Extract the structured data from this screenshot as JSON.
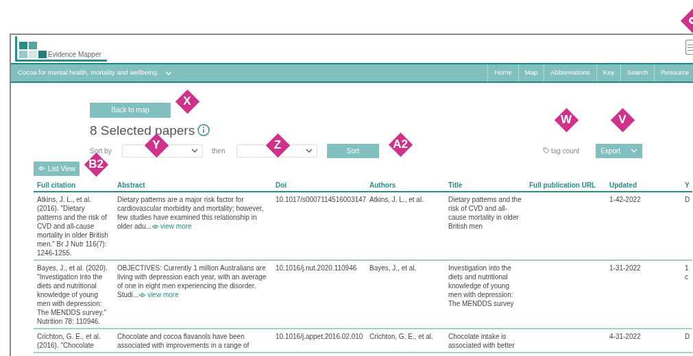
{
  "header": {
    "logo_text": "Evidence Mapper"
  },
  "nav": {
    "topic": "Cocoa for mental health, mortality and wellbeing.",
    "links": [
      "Home",
      "Map",
      "Abbreviations",
      "Key",
      "Search",
      "Resource"
    ]
  },
  "back_button": "Back to map",
  "heading": "8 Selected papers",
  "sort": {
    "label": "Sort by",
    "then": "then",
    "button": "Sort"
  },
  "tag_count": "tag count",
  "export_button": "Export",
  "list_view_button": "List View",
  "table": {
    "columns": [
      "Full citation",
      "Abstract",
      "Doi",
      "Authors",
      "Title",
      "Full publication URL",
      "Updated",
      "Y"
    ],
    "rows": [
      {
        "cells": [
          "Atkins, J. L., et al. (2016). \"Dietary patterns and the risk of CVD and all-cause mortality in older British men.\" Br J Nutr 116(7): 1246-1255.",
          "Dietary patterns are a major risk factor for cardiovascular morbidity and mortality; however, few studies have examined this relationship in older adu...",
          "10.1017/s0007114516003147",
          "Atkins, J. L., et al.",
          "Dietary patterns and the risk of CVD and all-cause mortality in older British men",
          "",
          "1-42-2022",
          "D"
        ],
        "view_more": "view more"
      },
      {
        "cells": [
          "Bayes, J., et al. (2020). \"Investigation into the diets and nutritional knowledge of young men with depression: The MENDDS survey.\" Nutrition 78: 110946.",
          "OBJECTIVES: Currently 1 million Australians are living with depression each year, with an average of one in eight men experiencing the disorder. Studi...",
          "10.1016/j.nut.2020.110946",
          "Bayes, J., et al.",
          "Investigation into the diets and nutritional knowledge of young men with depression: The MENDDS survey",
          "",
          "1-31-2022",
          "1\nc"
        ],
        "view_more": "view more"
      },
      {
        "cells": [
          "Crichton, G. E., et al. (2016). \"Chocolate",
          "Chocolate and cocoa flavanols have been associated with improvements in a range of",
          "10.1016/j.appet.2016.02.010",
          "Crichton, G. E., et al.",
          "Chocolate intake is associated with better",
          "",
          "4-31-2022",
          "D"
        ]
      }
    ]
  },
  "markers": [
    {
      "label": "X"
    },
    {
      "label": "W"
    },
    {
      "label": "V"
    },
    {
      "label": "Y"
    },
    {
      "label": "Z"
    },
    {
      "label": "A2"
    },
    {
      "label": "B2"
    },
    {
      "kind": "partial"
    }
  ]
}
